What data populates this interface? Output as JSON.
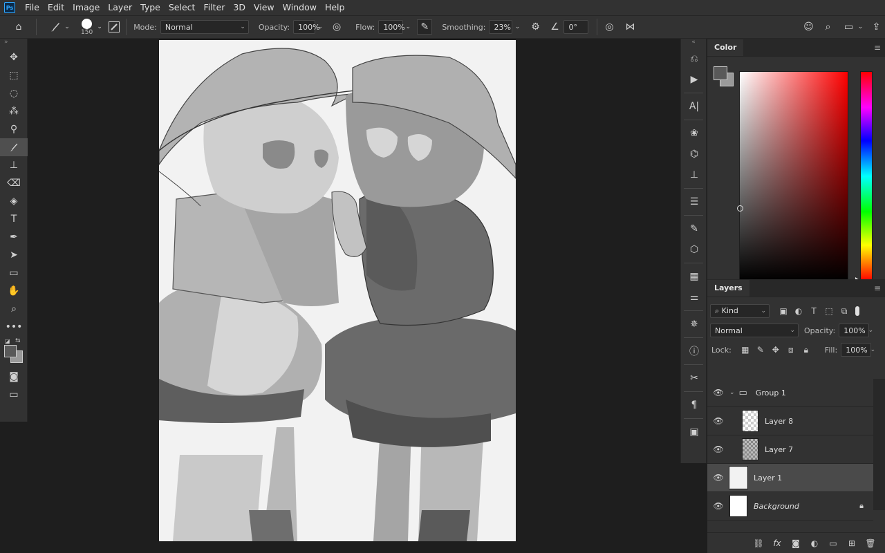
{
  "app": {
    "logo": "Ps"
  },
  "menu": [
    "File",
    "Edit",
    "Image",
    "Layer",
    "Type",
    "Select",
    "Filter",
    "3D",
    "View",
    "Window",
    "Help"
  ],
  "options": {
    "brush_size": "150",
    "mode_label": "Mode:",
    "mode_value": "Normal",
    "opacity_label": "Opacity:",
    "opacity_value": "100%",
    "flow_label": "Flow:",
    "flow_value": "100%",
    "smoothing_label": "Smoothing:",
    "smoothing_value": "23%",
    "angle_value": "0°"
  },
  "toolbar": [
    "move-tool",
    "marquee-tool",
    "lasso-tool",
    "magic-wand-tool",
    "eyedropper-tool",
    "brush-tool",
    "stamp-tool",
    "eraser-tool",
    "paint-bucket-tool",
    "type-tool",
    "pen-tool",
    "path-select-tool",
    "rectangle-tool",
    "hand-tool",
    "zoom-tool",
    "more-tools"
  ],
  "color_panel": {
    "tab": "Color",
    "foreground": "#595959",
    "background": "#9a9a9a"
  },
  "layers_panel": {
    "tab": "Layers",
    "filter_kind": "Kind",
    "blend_mode": "Normal",
    "opacity_label": "Opacity:",
    "opacity_value": "100%",
    "lock_label": "Lock:",
    "fill_label": "Fill:",
    "fill_value": "100%",
    "layers": [
      {
        "name": "Group 1",
        "type": "group"
      },
      {
        "name": "Layer 8",
        "type": "layer"
      },
      {
        "name": "Layer 7",
        "type": "layer"
      },
      {
        "name": "Layer 1",
        "type": "layer",
        "selected": true
      },
      {
        "name": "Background",
        "type": "background",
        "locked": true
      }
    ]
  },
  "colors": {
    "accent": "#31a8ff",
    "panel": "#323232",
    "workspace": "#1e1e1e"
  }
}
